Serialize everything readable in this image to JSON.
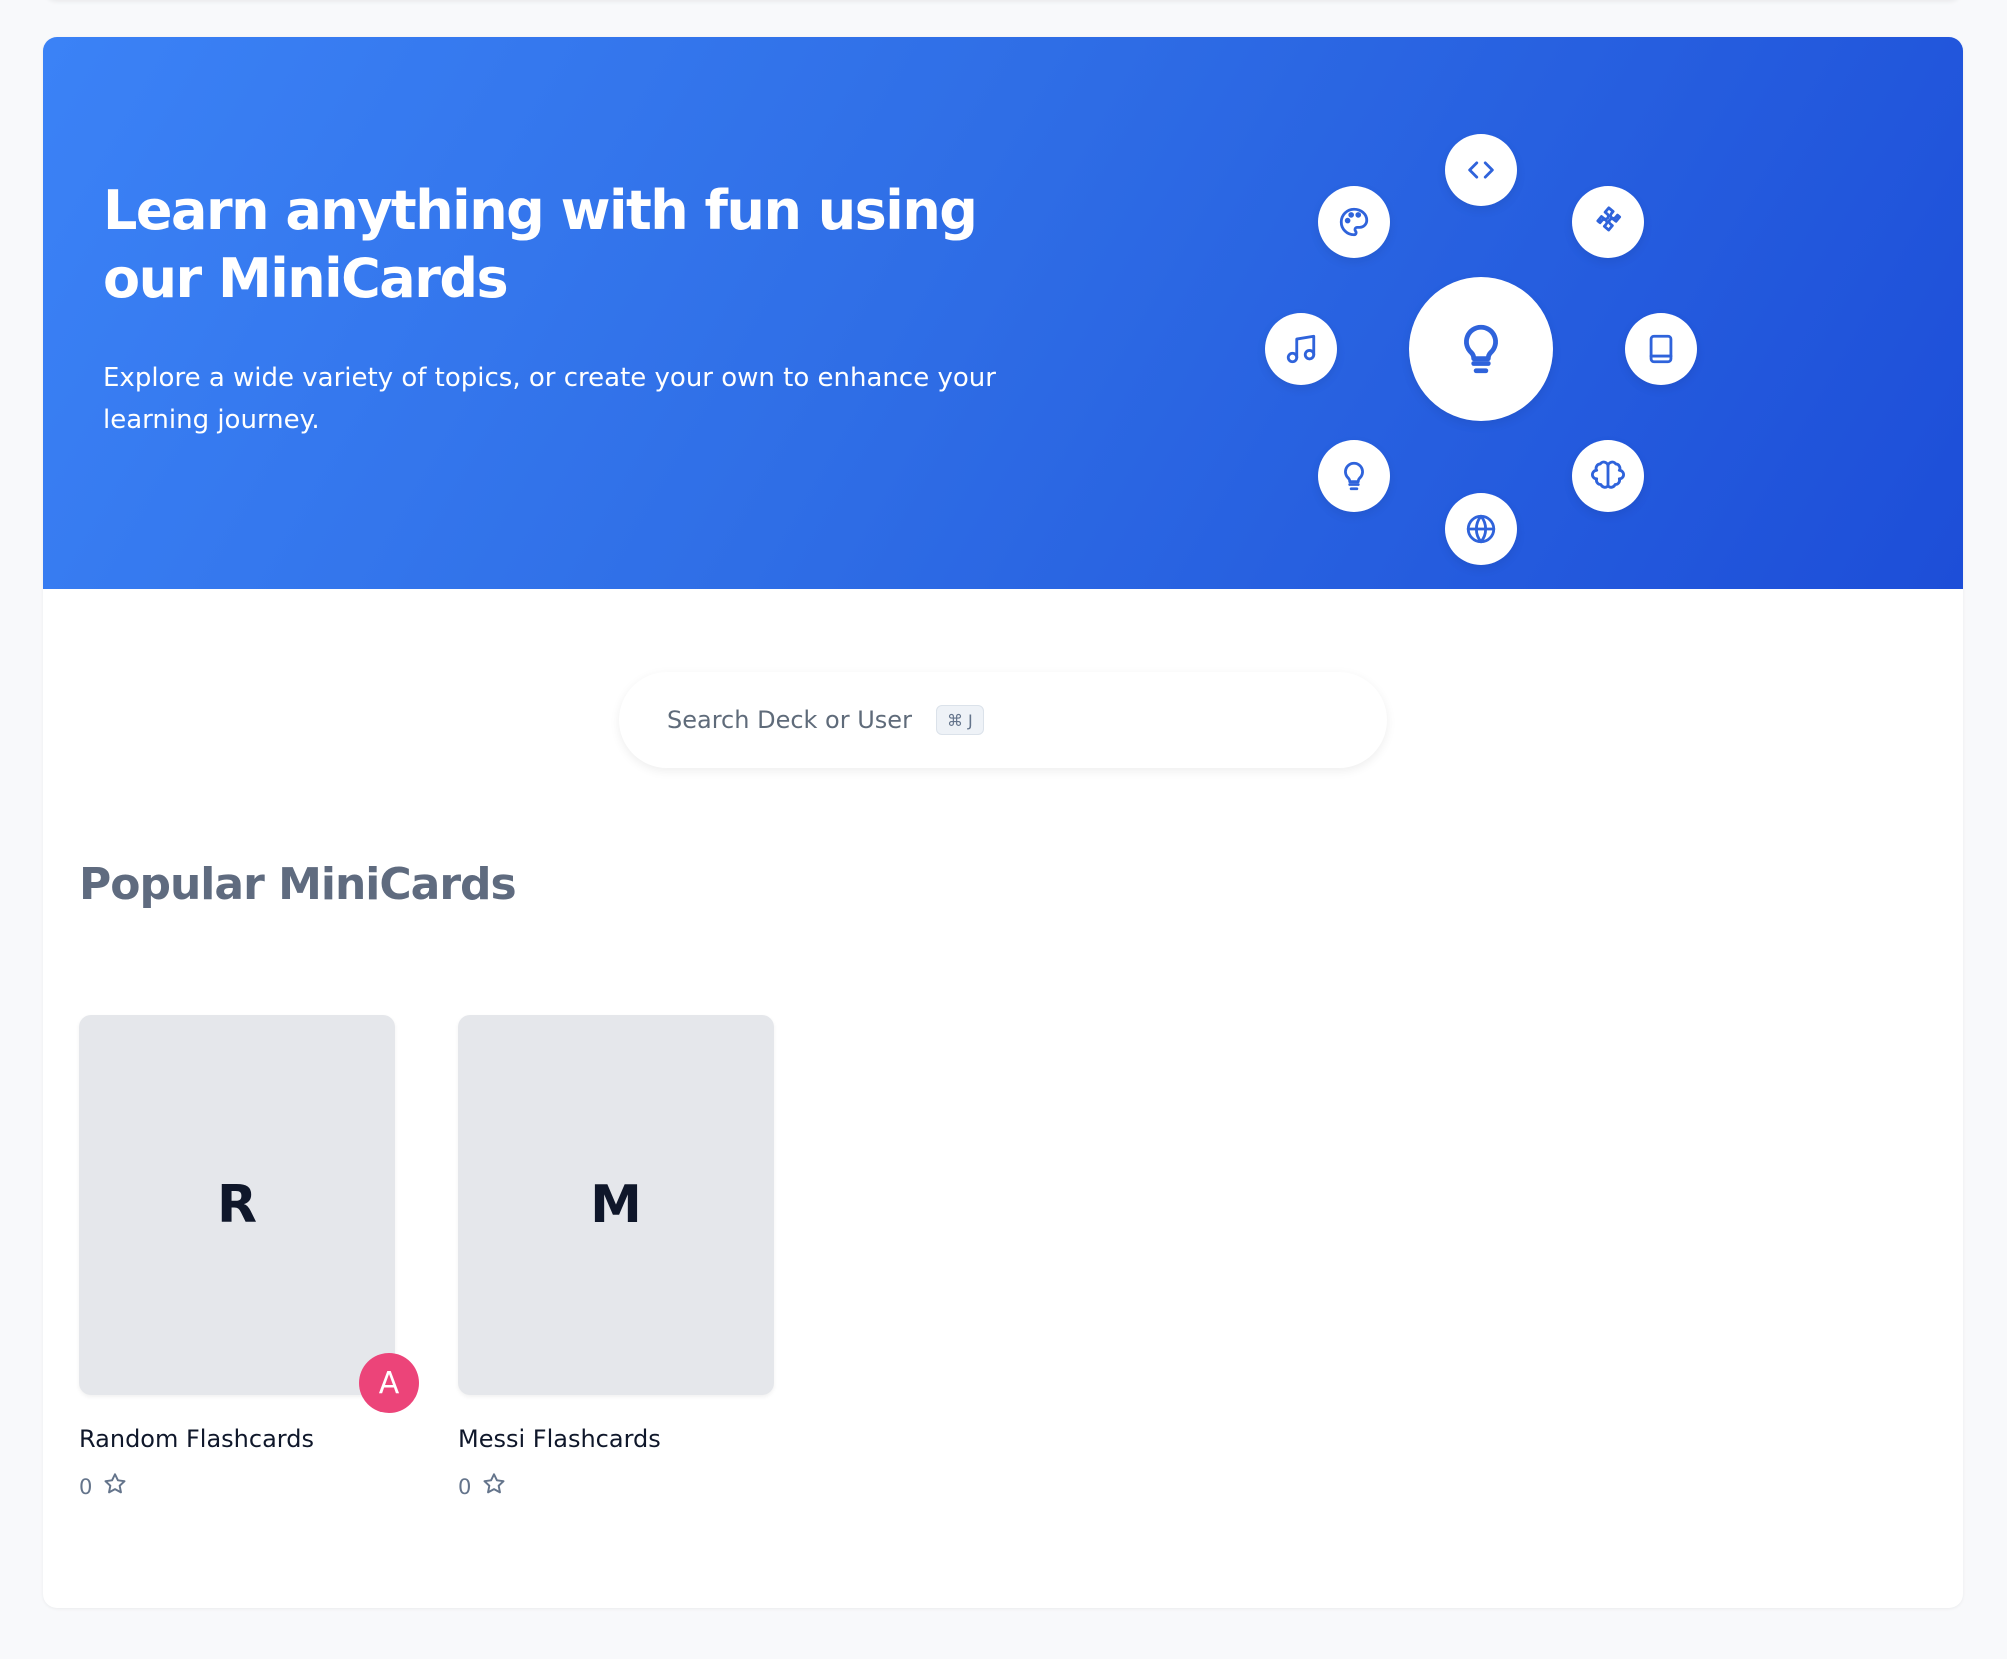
{
  "colors": {
    "hero_gradient_start": "#3b82f6",
    "hero_gradient_end": "#1d4ed8",
    "icon_blue": "#2f63db",
    "avatar_pink": "#ec4479",
    "section_title": "#5f6b7f"
  },
  "hero": {
    "title": "Learn anything with fun using our MiniCards",
    "subtitle": "Explore a wide variety of topics, or create your own to enhance your learning journey.",
    "icons": [
      "code-icon",
      "puzzle-icon",
      "book-icon",
      "brain-icon",
      "globe-icon",
      "lightbulb-small-icon",
      "music-icon",
      "palette-icon",
      "lightbulb-icon"
    ]
  },
  "search": {
    "placeholder": "Search Deck or User",
    "shortcut": "⌘ J"
  },
  "popular": {
    "title": "Popular MiniCards",
    "decks": [
      {
        "letter": "R",
        "name": "Random Flashcards",
        "stars": "0",
        "avatar": "A"
      },
      {
        "letter": "M",
        "name": "Messi Flashcards",
        "stars": "0",
        "avatar": ""
      }
    ]
  }
}
